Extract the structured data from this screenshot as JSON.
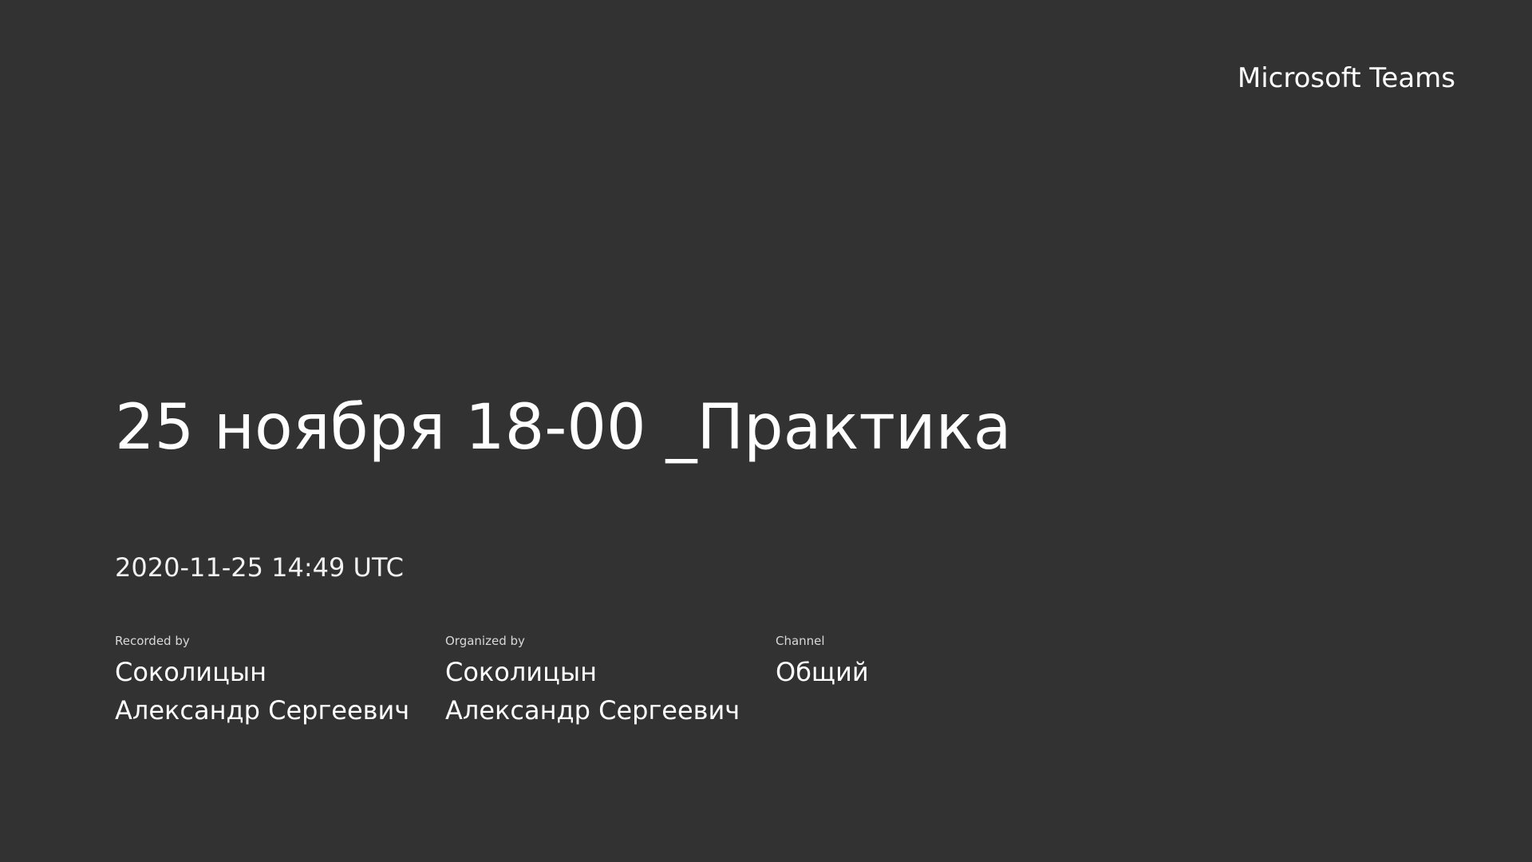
{
  "app": {
    "brand": "Microsoft Teams"
  },
  "meeting": {
    "title": "25 ноября 18-00 _Практика",
    "timestamp": "2020-11-25 14:49 UTC"
  },
  "details": [
    {
      "label": "Recorded by",
      "value": "Соколицын Александр Сергеевич"
    },
    {
      "label": "Organized by",
      "value": "Соколицын Александр Сергеевич"
    },
    {
      "label": "Channel",
      "value": "Общий"
    }
  ],
  "colors": {
    "background": "#323232",
    "text": "#ffffff"
  }
}
